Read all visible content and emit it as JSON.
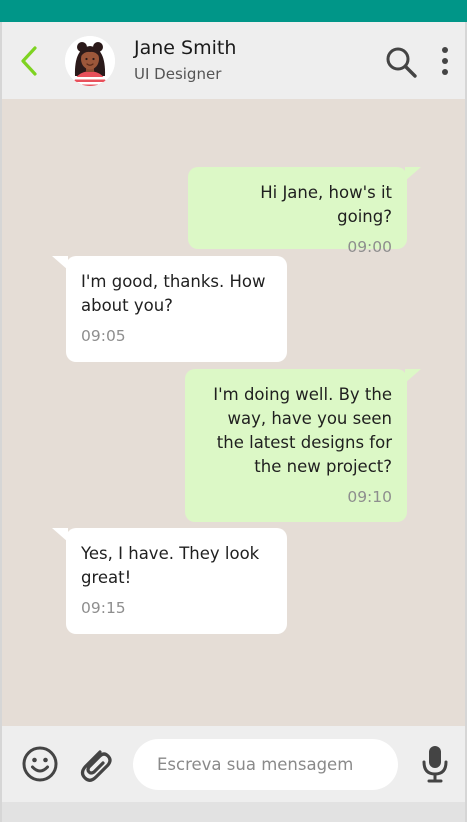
{
  "contact": {
    "name": "Jane Smith",
    "role": "UI Designer",
    "avatar": "avatar-woman-icon"
  },
  "icons": {
    "back": "chevron-left-icon",
    "search": "search-icon",
    "more": "more-vertical-icon",
    "emoji": "emoji-icon",
    "attach": "paperclip-icon",
    "mic": "microphone-icon"
  },
  "messages": [
    {
      "direction": "sent",
      "text": "Hi Jane, how's it going?",
      "time": "09:00"
    },
    {
      "direction": "received",
      "text": "I'm good, thanks. How about you?",
      "time": "09:05"
    },
    {
      "direction": "sent",
      "text": "I'm doing well. By the way, have you seen the latest designs for the new project?",
      "time": "09:10"
    },
    {
      "direction": "received",
      "text": "Yes, I have. They look great!",
      "time": "09:15"
    }
  ],
  "composer": {
    "placeholder": "Escreva sua mensagem"
  },
  "colors": {
    "status_bar": "#009688",
    "back_accent": "#7ed321",
    "sent_bubble": "#dcf8c6",
    "received_bubble": "#ffffff",
    "chat_background": "#e5ddd6"
  }
}
